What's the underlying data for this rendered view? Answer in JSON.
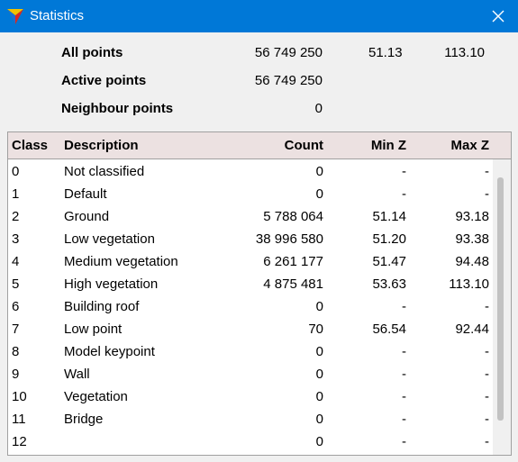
{
  "window": {
    "title": "Statistics",
    "title_bar_color": "#0078d7"
  },
  "icons": {
    "app": "app-logo-icon",
    "close": "close-icon"
  },
  "summary": [
    {
      "label": "All points",
      "count": "56 749 250",
      "min_z": "51.13",
      "max_z": "113.10"
    },
    {
      "label": "Active points",
      "count": "56 749 250",
      "min_z": "",
      "max_z": ""
    },
    {
      "label": "Neighbour points",
      "count": "0",
      "min_z": "",
      "max_z": ""
    }
  ],
  "table": {
    "header_color": "#ece1e1",
    "columns": [
      "Class",
      "Description",
      "Count",
      "Min Z",
      "Max Z"
    ],
    "rows": [
      {
        "cls": "0",
        "desc": "Not classified",
        "count": "0",
        "min": "-",
        "max": "-"
      },
      {
        "cls": "1",
        "desc": "Default",
        "count": "0",
        "min": "-",
        "max": "-"
      },
      {
        "cls": "2",
        "desc": "Ground",
        "count": "5 788 064",
        "min": "51.14",
        "max": "93.18"
      },
      {
        "cls": "3",
        "desc": "Low vegetation",
        "count": "38 996 580",
        "min": "51.20",
        "max": "93.38"
      },
      {
        "cls": "4",
        "desc": "Medium vegetation",
        "count": "6 261 177",
        "min": "51.47",
        "max": "94.48"
      },
      {
        "cls": "5",
        "desc": "High vegetation",
        "count": "4 875 481",
        "min": "53.63",
        "max": "113.10"
      },
      {
        "cls": "6",
        "desc": "Building roof",
        "count": "0",
        "min": "-",
        "max": "-"
      },
      {
        "cls": "7",
        "desc": "Low point",
        "count": "70",
        "min": "56.54",
        "max": "92.44"
      },
      {
        "cls": "8",
        "desc": "Model keypoint",
        "count": "0",
        "min": "-",
        "max": "-"
      },
      {
        "cls": "9",
        "desc": "Wall",
        "count": "0",
        "min": "-",
        "max": "-"
      },
      {
        "cls": "10",
        "desc": "Vegetation",
        "count": "0",
        "min": "-",
        "max": "-"
      },
      {
        "cls": "11",
        "desc": "Bridge",
        "count": "0",
        "min": "-",
        "max": "-"
      },
      {
        "cls": "12",
        "desc": "",
        "count": "0",
        "min": "-",
        "max": "-"
      }
    ]
  }
}
